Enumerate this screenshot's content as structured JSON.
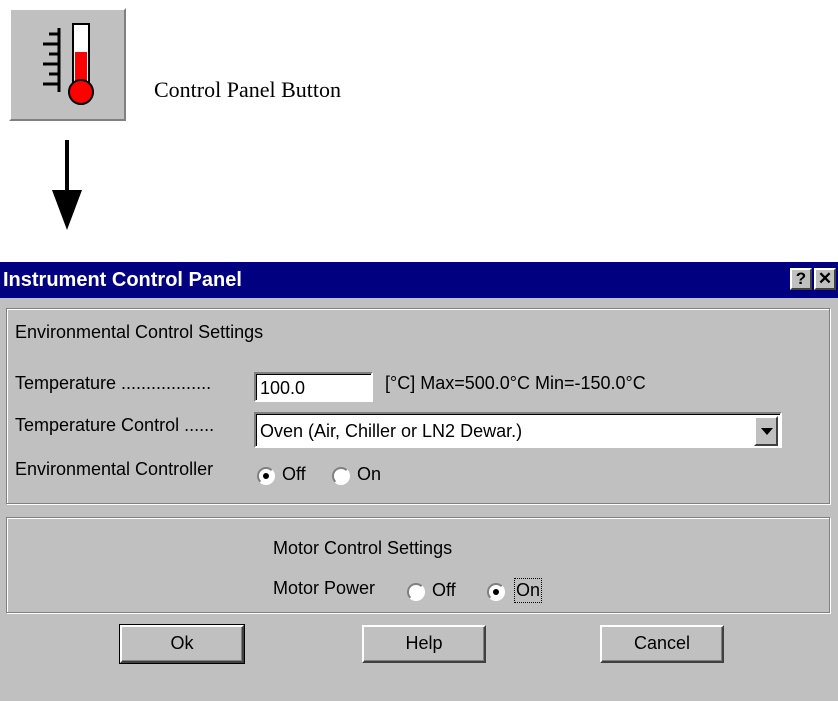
{
  "caption": "Control Panel Button",
  "dialog": {
    "title": "Instrument Control Panel",
    "help_glyph": "?",
    "close_glyph": "✕",
    "environmental": {
      "heading": "Environmental Control Settings",
      "temperature_label": "Temperature ..................",
      "temperature_value": "100.0",
      "temperature_range": "[°C] Max=500.0°C  Min=-150.0°C",
      "control_label": "Temperature Control ......",
      "control_value": "Oven (Air, Chiller or LN2 Dewar.)",
      "controller_label": "Environmental Controller",
      "off_label": "Off",
      "on_label": "On",
      "selected": "Off"
    },
    "motor": {
      "heading": "Motor Control Settings",
      "power_label": "Motor Power",
      "off_label": "Off",
      "on_label": "On",
      "selected": "On"
    },
    "buttons": {
      "ok": "Ok",
      "help": "Help",
      "cancel": "Cancel"
    }
  },
  "icons": {
    "control_panel": "thermometer-icon",
    "arrow": "down-arrow-icon",
    "dropdown": "chevron-down-icon"
  },
  "colors": {
    "titlebar": "#000080",
    "dialog_face": "#c0c0c0",
    "thermometer_red": "#ff0000"
  }
}
